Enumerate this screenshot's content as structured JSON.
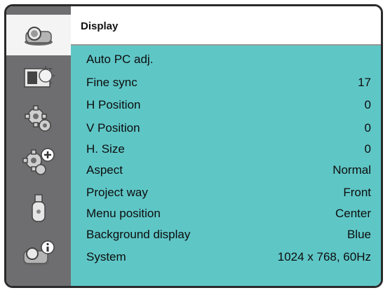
{
  "sidebar": {
    "tabs": [
      {
        "icon": "projector-icon",
        "active": true
      },
      {
        "icon": "picture-adjust-icon",
        "active": false
      },
      {
        "icon": "gear-icon",
        "active": false
      },
      {
        "icon": "gear-plus-icon",
        "active": false
      },
      {
        "icon": "usb-icon",
        "active": false
      },
      {
        "icon": "projector-info-icon",
        "active": false
      }
    ]
  },
  "header": {
    "title": "Display"
  },
  "menu": {
    "items": [
      {
        "label": "Auto PC adj.",
        "value": ""
      },
      {
        "label": "Fine sync",
        "value": "17"
      },
      {
        "label": "H Position",
        "value": "0"
      },
      {
        "label": "V Position",
        "value": "0"
      },
      {
        "label": "H. Size",
        "value": "0"
      },
      {
        "label": "Aspect",
        "value": "Normal"
      },
      {
        "label": "Project way",
        "value": "Front"
      },
      {
        "label": "Menu position",
        "value": "Center"
      },
      {
        "label": "Background display",
        "value": "Blue"
      },
      {
        "label": "System",
        "value": "1024 x 768, 60Hz"
      }
    ]
  },
  "colors": {
    "panel": "#5fc6c6",
    "sidebar": "#6e6e70",
    "accent": "#f4f4f4"
  }
}
